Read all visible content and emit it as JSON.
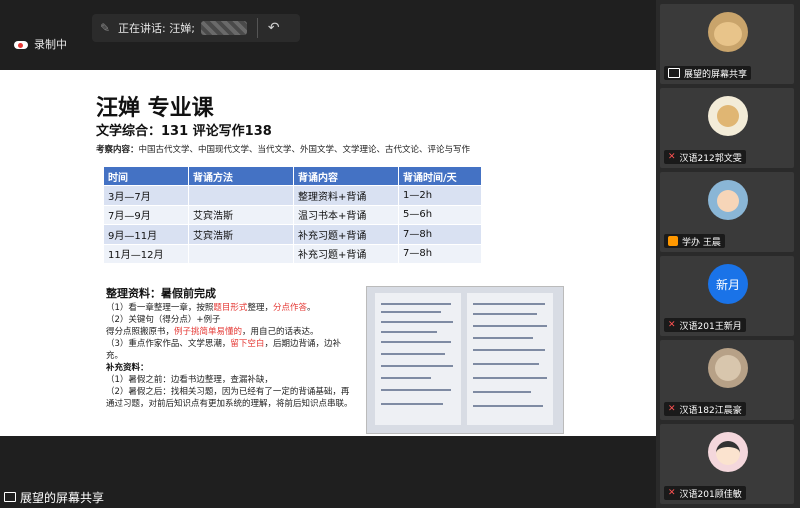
{
  "meeting": {
    "recording_label": "录制中",
    "speaking_label": "正在讲话: 汪婵;",
    "presenter_bar": "展望的屏幕共享"
  },
  "slide": {
    "title": "汪婵 专业课",
    "subtitle": "文学综合：131   评论写作138",
    "scope_label": "考察内容：",
    "scope_text": "中国古代文学、中国现代文学、当代文学、外国文学、文学理论、古代文论、评论与写作",
    "table": {
      "headers": [
        "时间",
        "背诵方法",
        "背诵内容",
        "背诵时间/天"
      ],
      "rows": [
        [
          "3月—7月",
          "",
          "整理资料+背诵",
          "1—2h"
        ],
        [
          "7月—9月",
          "艾宾浩斯",
          "温习书本+背诵",
          "5—6h"
        ],
        [
          "9月—11月",
          "艾宾浩斯",
          "补充习题+背诵",
          "7—8h"
        ],
        [
          "11月—12月",
          "",
          "补充习题+背诵",
          "7—8h"
        ]
      ]
    },
    "notes": {
      "heading": "整理资料：暑假前完成",
      "l1a": "（1）看一章整理一章，按照",
      "l1b": "题目形式",
      "l1c": "整理，",
      "l1d": "分点作答",
      "l1e": "。",
      "l2": "（2）关键句（得分点）+例子",
      "l3": "得分点照搬原书，",
      "l3r": "例子挑简单易懂的",
      "l3e": "，用自己的话表达。",
      "l4a": "（3）重点作家作品、文学思潮，",
      "l4r": "留下空白",
      "l4e": "，后期边背诵，边补充。",
      "sub_heading": "补充资料：",
      "l5": "（1）暑假之前：边看书边整理，查漏补缺，",
      "l6": "（2）暑假之后：找相关习题，因为已经有了一定的背诵基础，再通过习题，对前后知识点有更加系统的理解，将前后知识点串联。"
    }
  },
  "participants": [
    {
      "name": "展望的屏幕共享",
      "avatar": "shiba",
      "badge": "share"
    },
    {
      "name": "汉语212郭文雯",
      "avatar": "cartoon-dog",
      "badge": "mic-off"
    },
    {
      "name": "学办 王晨",
      "avatar": "cartoon-girl",
      "badge": "org"
    },
    {
      "name": "汉语201王新月",
      "avatar": "text",
      "avatar_text": "新月",
      "badge": "mic-off"
    },
    {
      "name": "汉语182江晨豪",
      "avatar": "photo",
      "badge": "mic-off"
    },
    {
      "name": "汉语201顾佳敏",
      "avatar": "cartoon-kid",
      "badge": "mic-off"
    }
  ],
  "colors": {
    "table_header": "#4472c4",
    "avatar_blue": "#1a73e8",
    "highlight_red": "#e53935"
  }
}
